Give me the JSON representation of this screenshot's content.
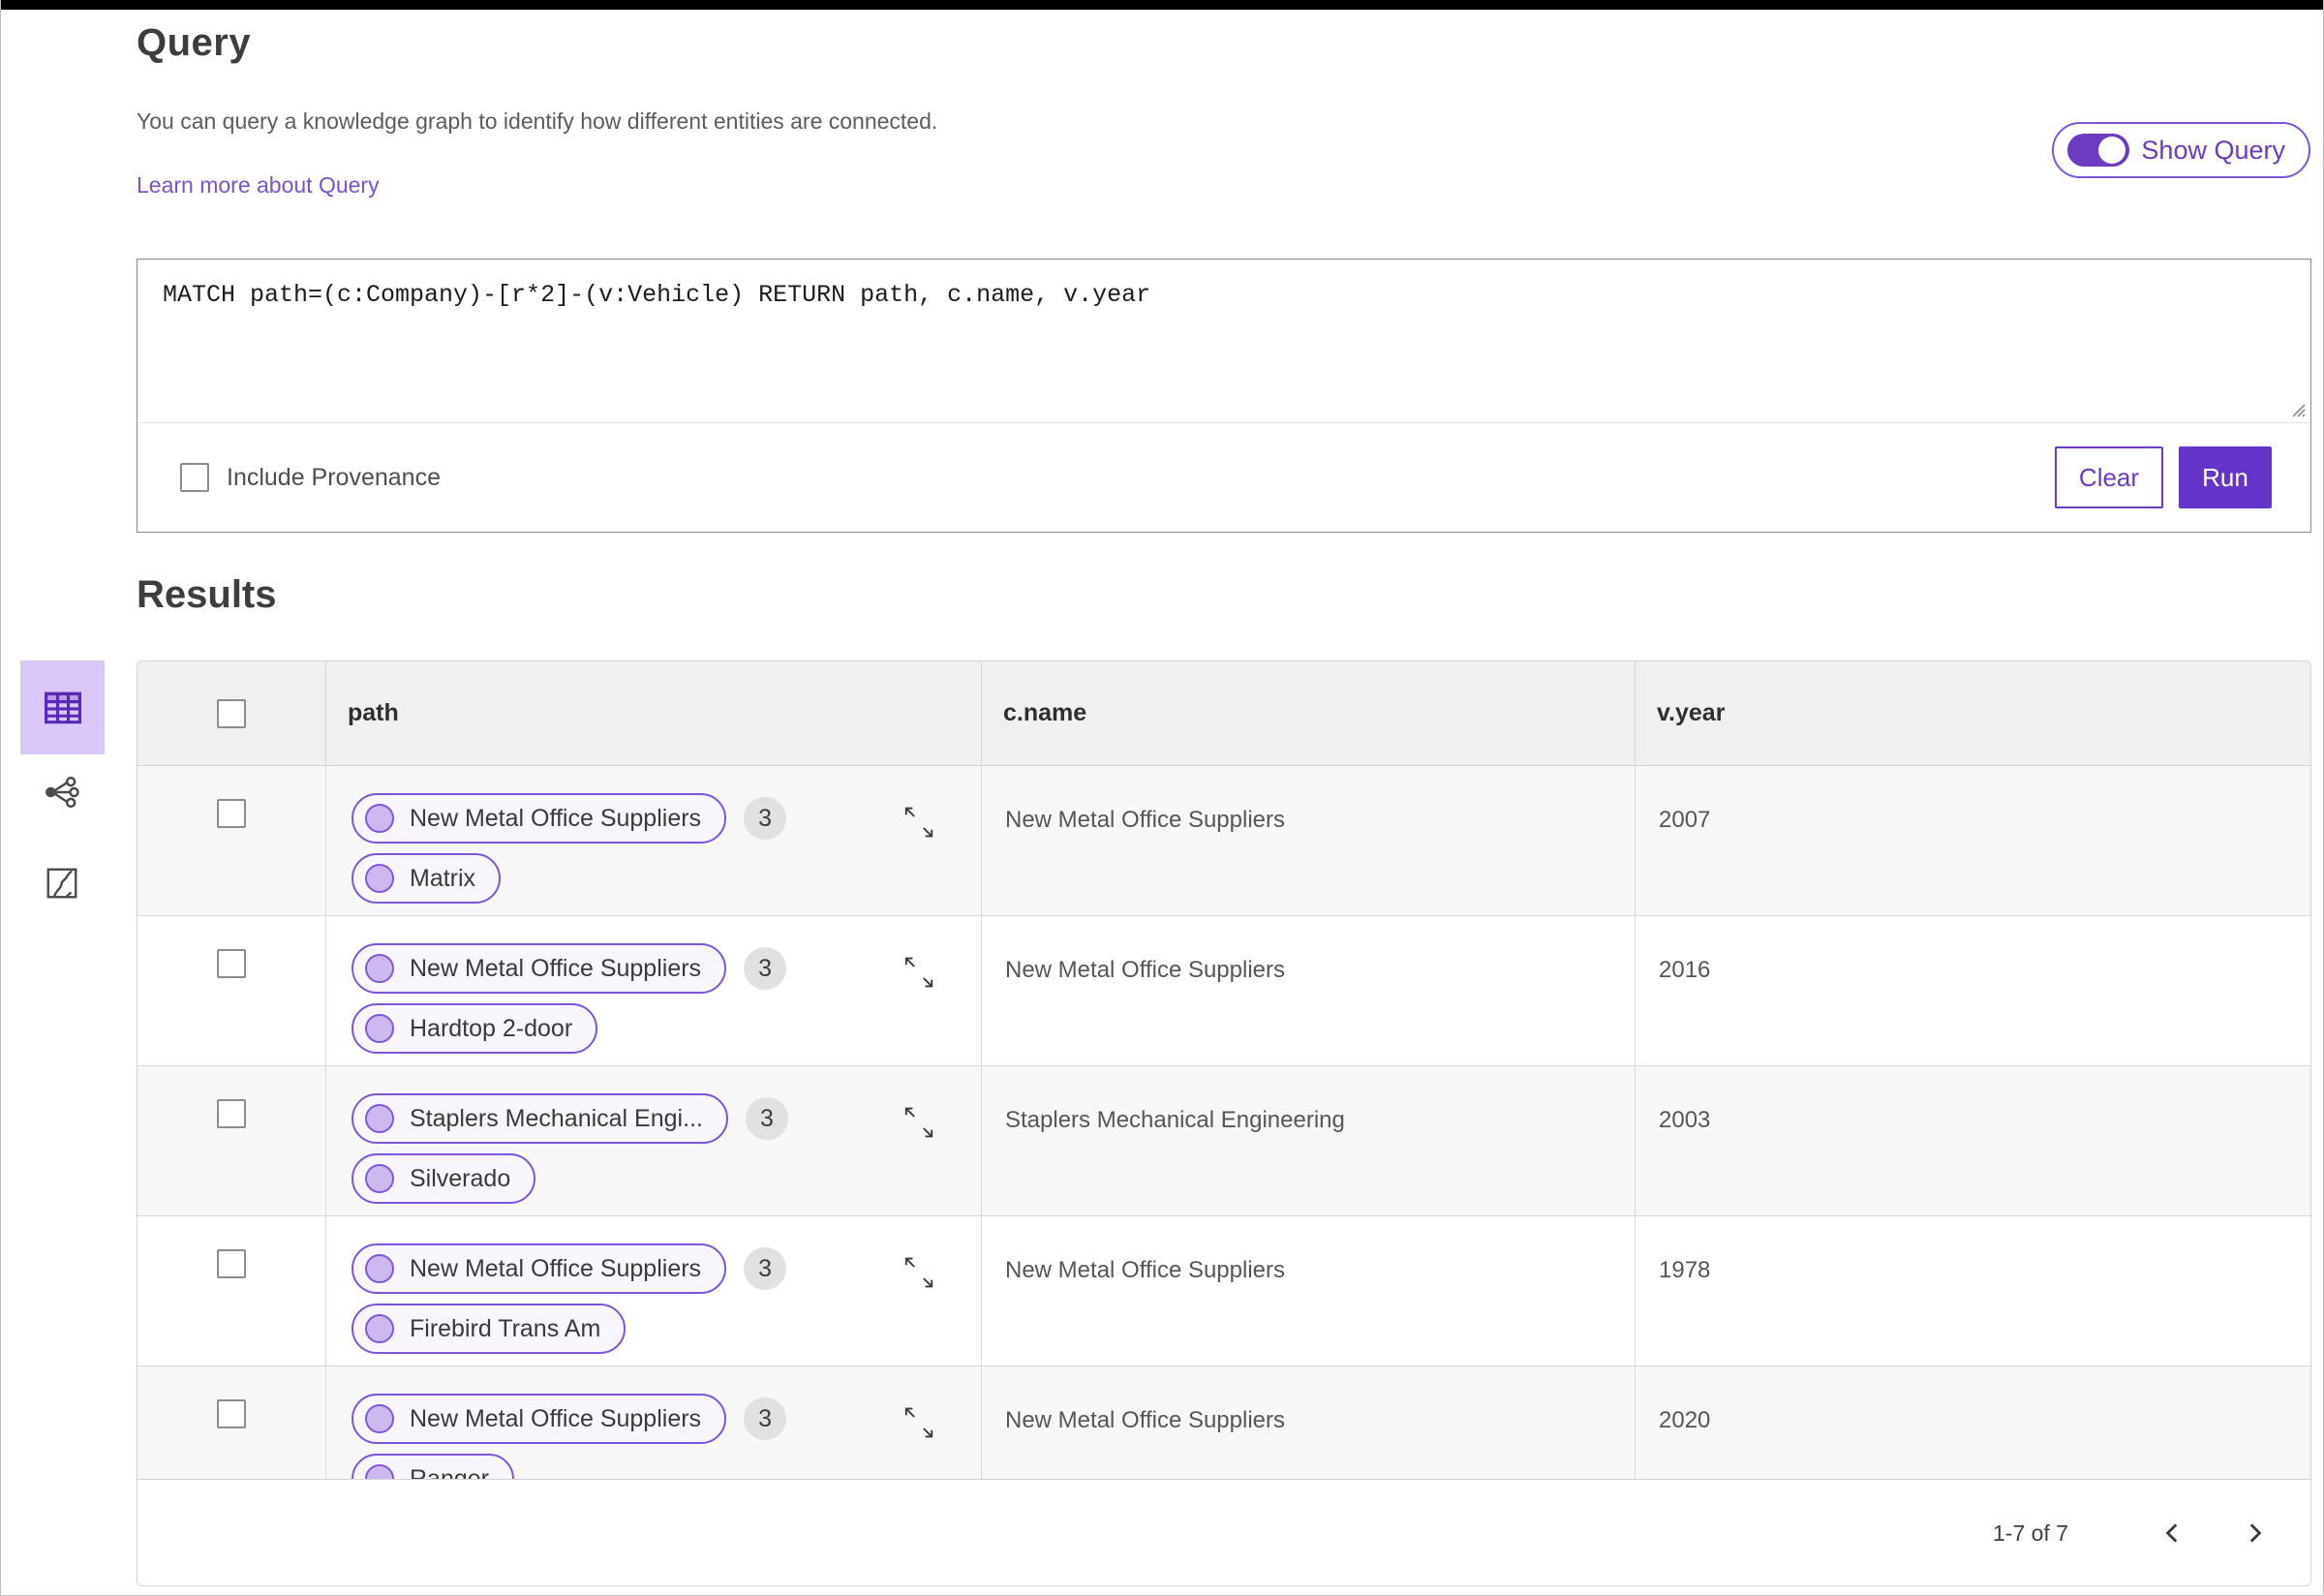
{
  "header": {
    "title": "Query",
    "description": "You can query a knowledge graph to identify how different entities are connected.",
    "learn_more": "Learn more about Query",
    "show_query_label": "Show Query",
    "show_query_on": true
  },
  "query_panel": {
    "query_text": "MATCH path=(c:Company)-[r*2]-(v:Vehicle) RETURN path, c.name, v.year",
    "include_provenance_label": "Include Provenance",
    "include_provenance_checked": false,
    "clear_label": "Clear",
    "run_label": "Run"
  },
  "results": {
    "title": "Results",
    "views": [
      {
        "icon": "table-view-icon",
        "selected": true
      },
      {
        "icon": "graph-view-icon",
        "selected": false
      },
      {
        "icon": "path-view-icon",
        "selected": false
      }
    ],
    "columns": [
      "path",
      "c.name",
      "v.year"
    ],
    "rows": [
      {
        "pills": [
          "New Metal Office Suppliers",
          "Matrix"
        ],
        "badge": "3",
        "c_name": "New Metal Office Suppliers",
        "v_year": "2007"
      },
      {
        "pills": [
          "New Metal Office Suppliers",
          "Hardtop 2-door"
        ],
        "badge": "3",
        "c_name": "New Metal Office Suppliers",
        "v_year": "2016"
      },
      {
        "pills": [
          "Staplers Mechanical Engi...",
          "Silverado"
        ],
        "badge": "3",
        "c_name": "Staplers Mechanical Engineering",
        "v_year": "2003"
      },
      {
        "pills": [
          "New Metal Office Suppliers",
          "Firebird Trans Am"
        ],
        "badge": "3",
        "c_name": "New Metal Office Suppliers",
        "v_year": "1978"
      },
      {
        "pills": [
          "New Metal Office Suppliers",
          "Ranger"
        ],
        "badge": "3",
        "c_name": "New Metal Office Suppliers",
        "v_year": "2020"
      }
    ],
    "pagination": {
      "label": "1-7 of 7"
    }
  },
  "colors": {
    "accent_purple": "#6534c8",
    "toggle_purple": "#6d3ac2",
    "link_purple": "#7a52cc",
    "pill_border": "#7e55d9",
    "pill_bg": "#f8f5fd",
    "node_dot": "#cdb9f0",
    "selected_view_bg": "#d8c7f7",
    "icon_purple": "#5a28b5",
    "badge_bg": "#e1e1e1",
    "header_row_bg": "#f0f0f0",
    "zebra_row_bg": "#f7f7f7",
    "table_border": "#d2d2d2"
  }
}
